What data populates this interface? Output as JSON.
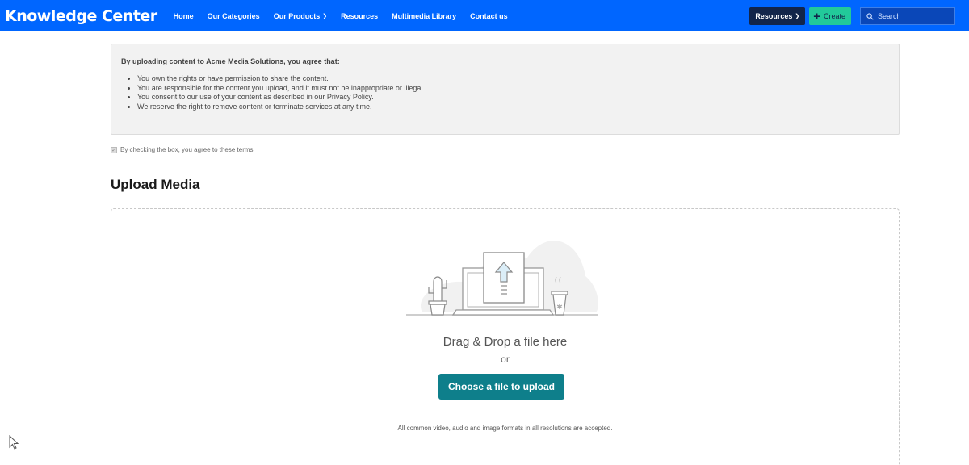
{
  "header": {
    "brand": "Knowledge Center",
    "nav": [
      "Home",
      "Our Categories",
      "Our Products",
      "Resources",
      "Multimedia Library",
      "Contact us"
    ],
    "resources_button": "Resources",
    "create_button": "Create",
    "search_placeholder": "Search"
  },
  "terms": {
    "title": "By uploading content to Acme Media Solutions, you agree that:",
    "items": [
      "You own the rights or have permission to share the content.",
      "You are responsible for the content you upload, and it must not be inappropriate or illegal.",
      "You consent to our use of your content as described in our Privacy Policy.",
      "We reserve the right to remove content or terminate services at any time."
    ],
    "agree_label": "By checking the box, you agree to these terms."
  },
  "upload": {
    "title": "Upload Media",
    "drop_text": "Drag & Drop a file here",
    "or_text": "or",
    "choose_button": "Choose a file to upload",
    "formats_note": "All common video, audio and image formats in all resolutions are accepted."
  },
  "colors": {
    "nav_bg": "#0066ff",
    "create_bg": "#22c99a",
    "resources_bg": "#12254a",
    "choose_bg": "#0e7f8b"
  }
}
